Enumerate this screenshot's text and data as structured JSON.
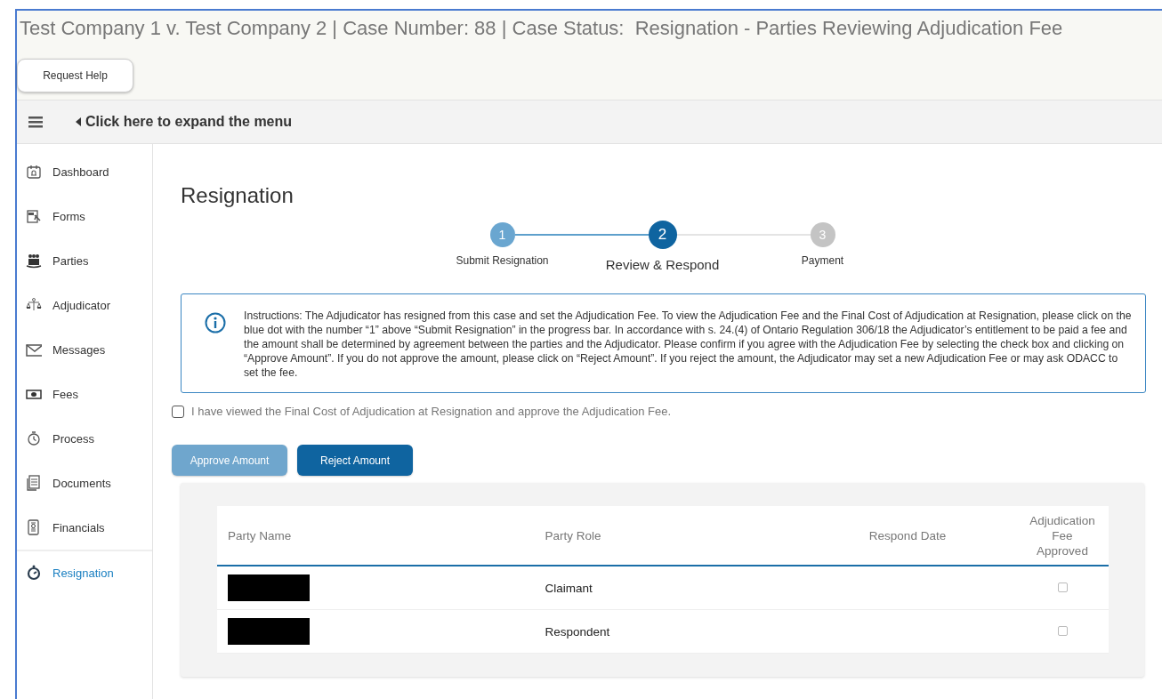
{
  "header": {
    "title": "Test Company 1 v. Test Company 2 | Case Number: 88 | Case Status:  Resignation - Parties Reviewing Adjudication Fee",
    "help_button": "Request Help"
  },
  "menu_bar": {
    "label": "Click here to expand the menu",
    "expanded": false
  },
  "sidebar": {
    "items": [
      {
        "label": "Dashboard",
        "selected": false
      },
      {
        "label": "Forms",
        "selected": false
      },
      {
        "label": "Parties",
        "selected": false
      },
      {
        "label": "Adjudicator",
        "selected": false
      },
      {
        "label": "Messages",
        "selected": false
      },
      {
        "label": "Fees",
        "selected": false
      },
      {
        "label": "Process",
        "selected": false
      },
      {
        "label": "Documents",
        "selected": false
      },
      {
        "label": "Financials",
        "selected": false
      },
      {
        "label": "Resignation",
        "selected": true
      }
    ]
  },
  "page_title": "Resignation",
  "stepper": [
    {
      "number": "1",
      "label": "Submit Resignation",
      "kind": "done"
    },
    {
      "number": "2",
      "label": "Review & Respond",
      "kind": "current"
    },
    {
      "number": "3",
      "label": "Payment",
      "kind": "pending"
    }
  ],
  "instructions": "Instructions: The Adjudicator has resigned from this case and set the Adjudication Fee. To view the Adjudication Fee and the Final Cost of Adjudication at Resignation, please click on the blue dot with the number “1” above “Submit Resignation” in the progress bar. In accordance with s. 24.(4) of Ontario Regulation 306/18 the Adjudicator’s entitlement to be paid a fee and the amount shall be determined by agreement between the parties and the Adjudicator. Please confirm if you agree with the Adjudication Fee by selecting the check box and clicking on “Approve Amount”. If you do not approve the amount, please click on “Reject Amount”. If you reject the amount, the Adjudicator may set a new Adjudication Fee or may ask ODACC to set the fee.",
  "approval": {
    "label": "I have viewed the Final Cost of Adjudication at Resignation and approve the Adjudication Fee.",
    "checked": false
  },
  "buttons": [
    {
      "label": "Approve Amount",
      "disabled": true
    },
    {
      "label": "Reject Amount",
      "disabled": false
    }
  ],
  "table": {
    "columns": [
      "Party Name",
      "Party Role",
      "Respond Date",
      "Adjudication Fee Approved"
    ],
    "rows": [
      {
        "name_redacted": true,
        "role": "Claimant",
        "approved": false
      },
      {
        "name_redacted": true,
        "role": "Respondent",
        "approved": false
      }
    ]
  }
}
